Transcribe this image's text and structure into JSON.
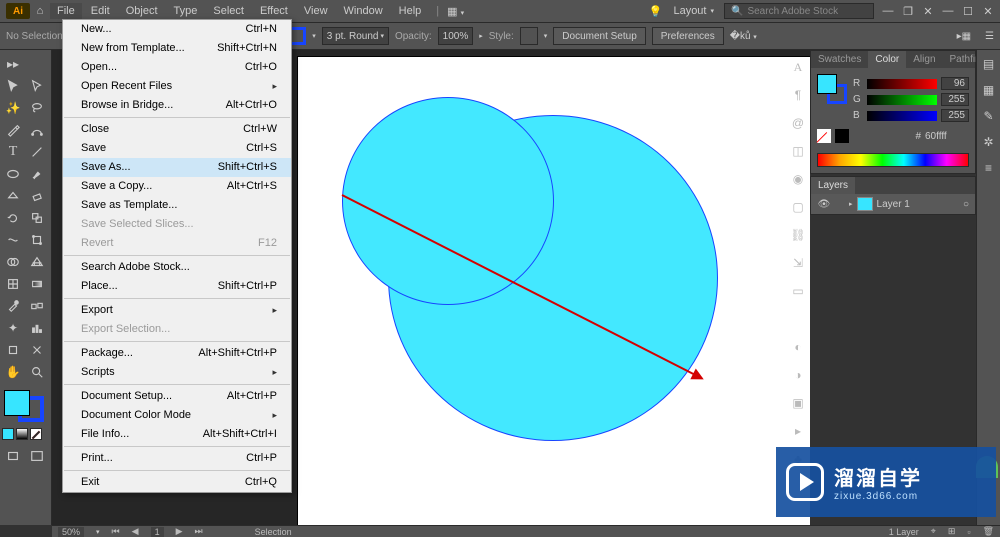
{
  "menubar": {
    "items": [
      "File",
      "Edit",
      "Object",
      "Type",
      "Select",
      "Effect",
      "View",
      "Window",
      "Help"
    ],
    "layout_label": "Layout",
    "search_placeholder": "Search Adobe Stock"
  },
  "options": {
    "no_selection": "No Selection",
    "stroke_weight": "3 pt. Round",
    "opacity_label": "Opacity:",
    "opacity_value": "100%",
    "style_label": "Style:",
    "doc_setup": "Document Setup",
    "preferences": "Preferences"
  },
  "file_menu": [
    {
      "label": "New...",
      "shortcut": "Ctrl+N"
    },
    {
      "label": "New from Template...",
      "shortcut": "Shift+Ctrl+N"
    },
    {
      "label": "Open...",
      "shortcut": "Ctrl+O"
    },
    {
      "label": "Open Recent Files",
      "sub": true
    },
    {
      "label": "Browse in Bridge...",
      "shortcut": "Alt+Ctrl+O"
    },
    {
      "sep": true
    },
    {
      "label": "Close",
      "shortcut": "Ctrl+W"
    },
    {
      "label": "Save",
      "shortcut": "Ctrl+S"
    },
    {
      "label": "Save As...",
      "shortcut": "Shift+Ctrl+S",
      "highlight": true
    },
    {
      "label": "Save a Copy...",
      "shortcut": "Alt+Ctrl+S"
    },
    {
      "label": "Save as Template..."
    },
    {
      "label": "Save Selected Slices...",
      "disabled": true
    },
    {
      "label": "Revert",
      "shortcut": "F12",
      "disabled": true
    },
    {
      "sep": true
    },
    {
      "label": "Search Adobe Stock..."
    },
    {
      "label": "Place...",
      "shortcut": "Shift+Ctrl+P"
    },
    {
      "sep": true
    },
    {
      "label": "Export",
      "sub": true
    },
    {
      "label": "Export Selection...",
      "disabled": true
    },
    {
      "sep": true
    },
    {
      "label": "Package...",
      "shortcut": "Alt+Shift+Ctrl+P"
    },
    {
      "label": "Scripts",
      "sub": true
    },
    {
      "sep": true
    },
    {
      "label": "Document Setup...",
      "shortcut": "Alt+Ctrl+P"
    },
    {
      "label": "Document Color Mode",
      "sub": true
    },
    {
      "label": "File Info...",
      "shortcut": "Alt+Shift+Ctrl+I"
    },
    {
      "sep": true
    },
    {
      "label": "Print...",
      "shortcut": "Ctrl+P"
    },
    {
      "sep": true
    },
    {
      "label": "Exit",
      "shortcut": "Ctrl+Q"
    }
  ],
  "panels": {
    "tabs_row1": [
      "Swatches",
      "Color",
      "Align",
      "Pathfinder"
    ],
    "active_tab1": "Color",
    "rgb": {
      "r": "96",
      "g": "255",
      "b": "255"
    },
    "hex_label": "#",
    "hex_value": "60ffff",
    "layers_tab": "Layers",
    "layer_name": "Layer 1"
  },
  "status": {
    "zoom": "50%",
    "page": "1",
    "tool": "Selection",
    "layer_count": "1 Layer"
  },
  "watermark": {
    "cn": "溜溜自学",
    "en": "zixue.3d66.com"
  },
  "colors": {
    "fill": "#37e5ff",
    "stroke": "#1745ff"
  }
}
